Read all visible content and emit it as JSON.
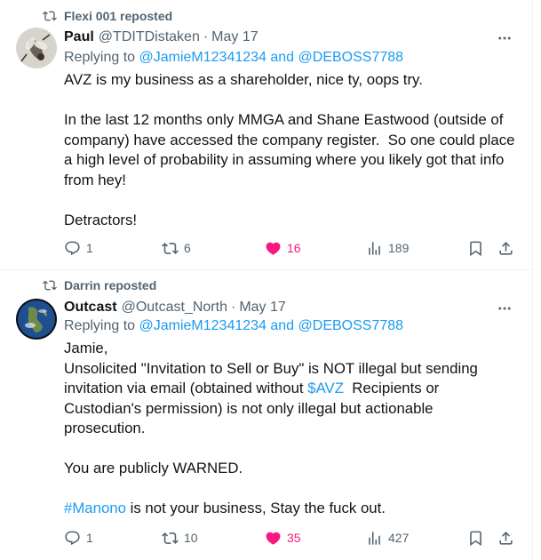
{
  "tweets": [
    {
      "repost_label": "Flexi 001 reposted",
      "name": "Paul",
      "handle": "@TDITDistaken",
      "dot": "·",
      "date": "May 17",
      "replying_prefix": "Replying to ",
      "replying_to": "@JamieM12341234 and @DEBOSS7788",
      "body": {
        "line1": "AVZ is my business as a shareholder, nice ty, oops try.",
        "para2": "In the last 12 months only MMGA and Shane Eastwood (outside of company) have accessed the company register.  So one could place a high level of probability in assuming where you likely got that info from hey!",
        "para3": "Detractors!"
      },
      "replies": "1",
      "reposts": "6",
      "likes": "16",
      "views": "189",
      "avatar_icon": "fly-photo-avatar"
    },
    {
      "repost_label": "Darrin reposted",
      "name": "Outcast",
      "handle": "@Outcast_North",
      "dot": "·",
      "date": "May 17",
      "replying_prefix": "Replying to ",
      "replying_to": "@JamieM12341234 and @DEBOSS7788",
      "body": {
        "line1": "Jamie,",
        "para2_pre": "Unsolicited \"Invitation to Sell or Buy\" is NOT illegal but sending invitation via email (obtained without ",
        "cashtag": "$AVZ",
        "para2_post": "  Recipients or Custodian's permission) is not only illegal but actionable prosecution.",
        "para3": "You are publicly WARNED.",
        "hashtag": "#Manono",
        "para4_post": " is not your business, Stay the fuck out."
      },
      "replies": "1",
      "reposts": "10",
      "likes": "35",
      "views": "427",
      "avatar_icon": "earth-globe-avatar"
    }
  ],
  "colors": {
    "text": "#0f1419",
    "secondary": "#536471",
    "link": "#1d9bf0",
    "like": "#f91880",
    "divider": "#eff3f4"
  },
  "icons": [
    "repost-icon",
    "more-icon",
    "reply-icon",
    "repost-icon",
    "like-icon",
    "views-icon",
    "bookmark-icon",
    "share-icon"
  ]
}
